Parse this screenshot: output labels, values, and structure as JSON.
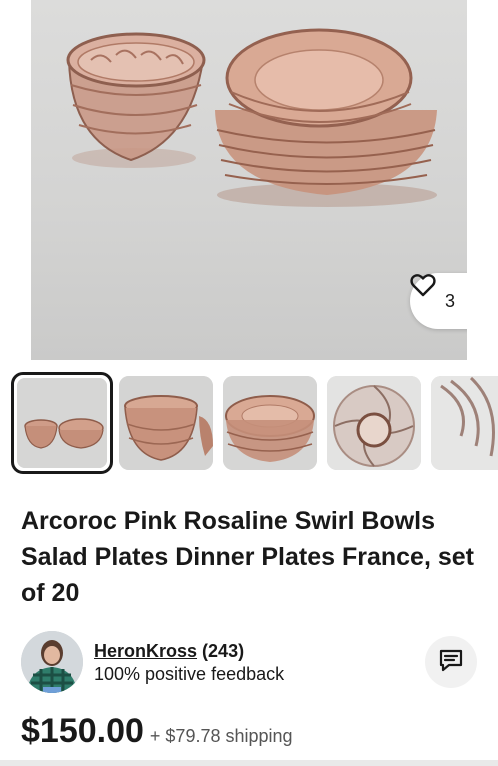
{
  "listing": {
    "title": "Arcoroc Pink Rosaline Swirl Bowls Salad Plates Dinner Plates France, set of 20",
    "like_count": "3",
    "images": {
      "total_visible_thumbs": 5,
      "selected_index": 0
    }
  },
  "seller": {
    "name": "HeronKross",
    "rating_count": "(243)",
    "feedback": "100% positive feedback"
  },
  "pricing": {
    "price": "$150.00",
    "shipping": "+ $79.78 shipping"
  },
  "icons": {
    "like": "heart-icon",
    "chat": "message-icon"
  },
  "colors": {
    "glass_pink": "#c98f78",
    "background_gray": "#d5d5d4",
    "text_primary": "#191919"
  }
}
